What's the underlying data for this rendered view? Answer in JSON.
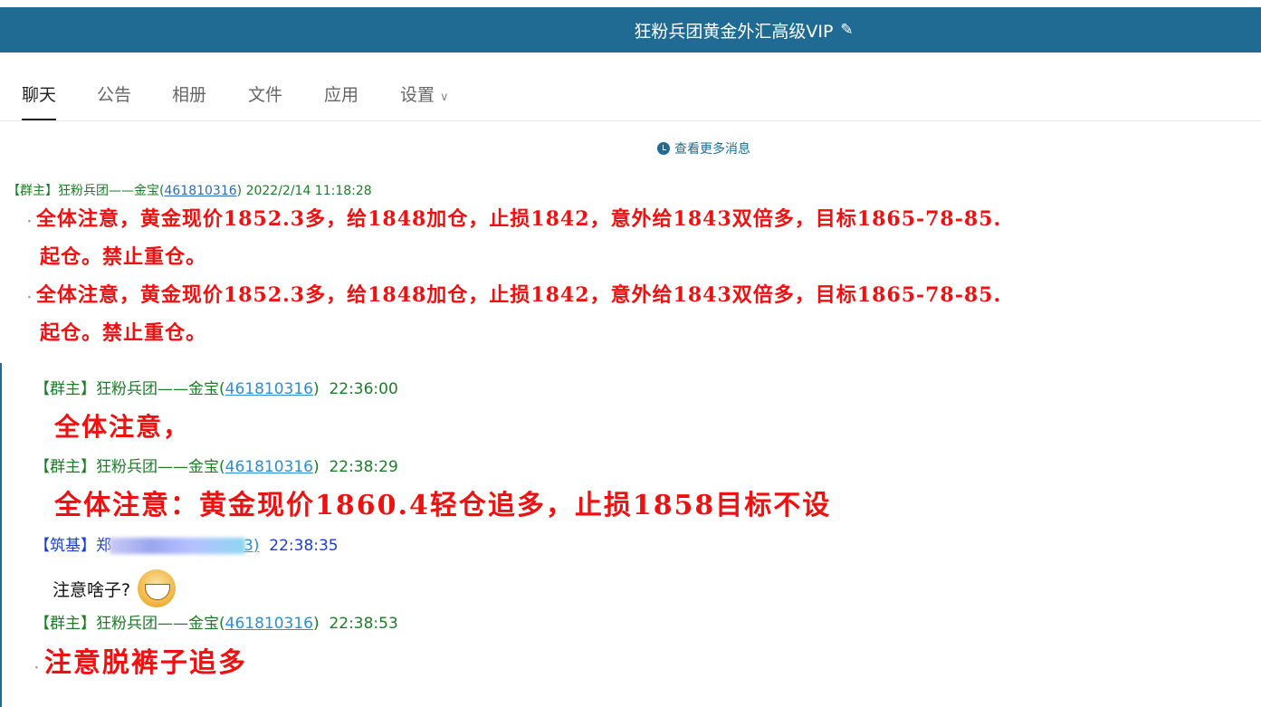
{
  "title": "狂粉兵团黄金外汇高级VIP",
  "edit_icon": "✎",
  "tabs": [
    {
      "label": "聊天",
      "active": true
    },
    {
      "label": "公告"
    },
    {
      "label": "相册"
    },
    {
      "label": "文件"
    },
    {
      "label": "应用"
    },
    {
      "label": "设置"
    }
  ],
  "settings_chevron": "∨",
  "more_messages": "查看更多消息",
  "top_message": {
    "role": "【群主】",
    "name": "狂粉兵团——金宝(",
    "qq": "461810316",
    "close": ")",
    "time": "2022/2/14 11:18:28",
    "lines": [
      "全体注意，黄金现价1852.3多，给1848加仓，止损1842，意外给1843双倍多，目标1865-78-85.",
      "起仓。禁止重仓。",
      "全体注意，黄金现价1852.3多，给1848加仓，止损1842，意外给1843双倍多，目标1865-78-85.",
      "起仓。禁止重仓。"
    ]
  },
  "messages": [
    {
      "role": "【群主】",
      "name": "狂粉兵团——金宝",
      "qq": "461810316",
      "time": "22:36:00",
      "text": "全体注意，"
    },
    {
      "role": "【群主】",
      "name": "狂粉兵团——金宝",
      "qq": "461810316",
      "time": "22:38:29",
      "text": "全体注意：黄金现价1860.4轻仓追多，止损1858目标不设"
    },
    {
      "role": "【筑基】",
      "name": "郑",
      "qq_tail": "3)",
      "time": "22:38:35",
      "text": "注意啥子?"
    },
    {
      "role": "【群主】",
      "name": "狂粉兵团——金宝",
      "qq": "461810316",
      "time": "22:38:53",
      "text": "注意脱裤子追多"
    }
  ],
  "colors": {
    "titlebar": "#1f6b94",
    "owner_green": "#1a7d27",
    "member_blue": "#1c3fd1",
    "alert_red": "#ee1111",
    "qq_link": "#2a8fd6"
  }
}
